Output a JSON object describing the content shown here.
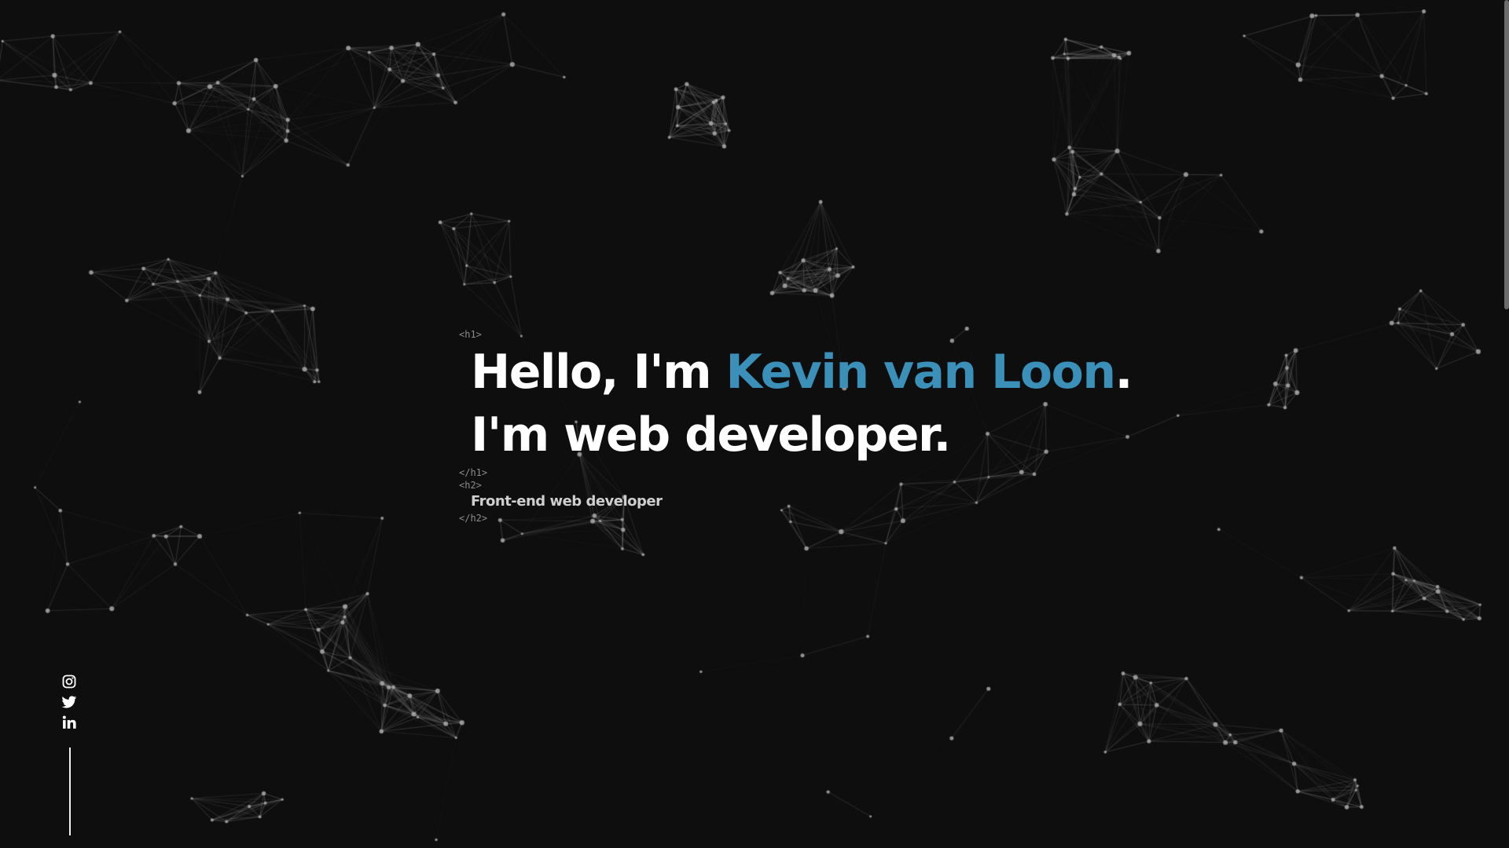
{
  "hero": {
    "h1_open_tag": "<h1>",
    "greeting": "Hello, I'm ",
    "name": "Kevin van Loon",
    "period": ".",
    "role_line": "I'm web developer.",
    "h1_close_tag": "</h1>",
    "h2_open_tag": "<h2>",
    "subtitle": "Front-end web developer",
    "h2_close_tag": "</h2>"
  },
  "social": [
    {
      "name": "instagram",
      "icon": "instagram-icon"
    },
    {
      "name": "twitter",
      "icon": "twitter-icon"
    },
    {
      "name": "linkedin",
      "icon": "linkedin-icon"
    }
  ],
  "colors": {
    "background": "#0e0e0f",
    "accent": "#3a90b8",
    "text": "#ffffff",
    "network": "#9a9a9a"
  }
}
